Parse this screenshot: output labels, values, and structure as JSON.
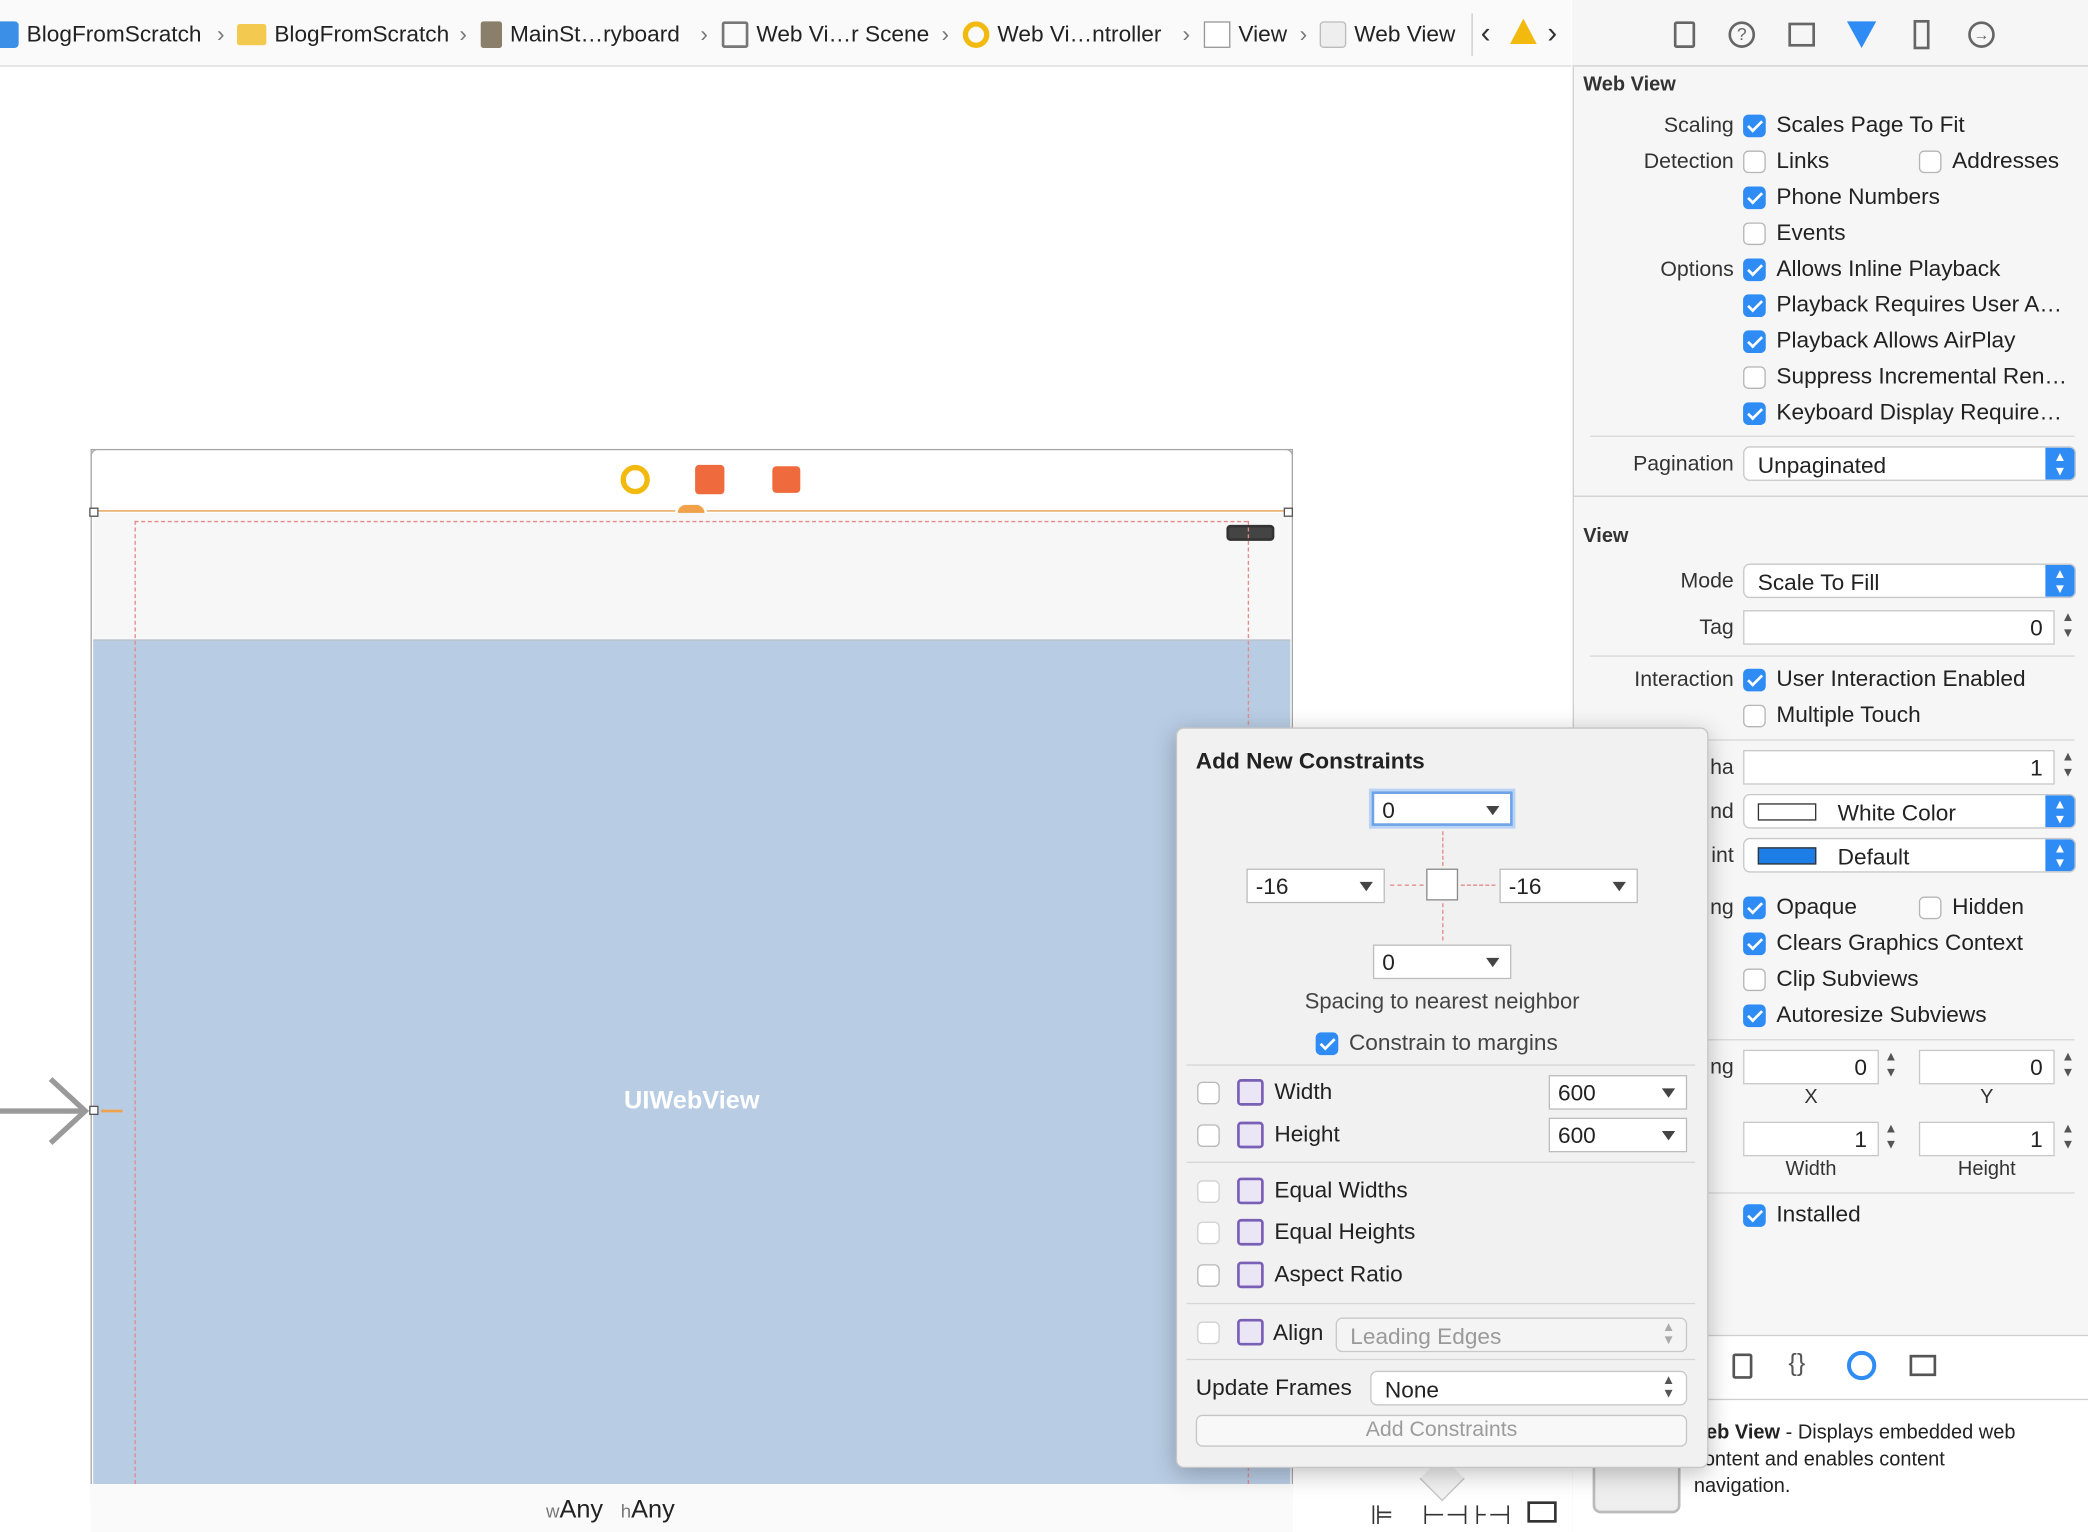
{
  "breadcrumb": [
    {
      "label": "BlogFromScratch",
      "icon": "project-icon"
    },
    {
      "label": "BlogFromScratch",
      "icon": "folder-icon"
    },
    {
      "label": "MainSt…ryboard",
      "icon": "storyboard-icon"
    },
    {
      "label": "Web Vi…r Scene",
      "icon": "scene-icon"
    },
    {
      "label": "Web Vi…ntroller",
      "icon": "view-controller-icon"
    },
    {
      "label": "View",
      "icon": "view-icon"
    },
    {
      "label": "Web View",
      "icon": "webview-icon"
    }
  ],
  "canvas": {
    "webview_label": "UIWebView",
    "size_class_w_prefix": "w",
    "size_class_w": "Any",
    "size_class_h_prefix": "h",
    "size_class_h": "Any"
  },
  "inspector": {
    "webview_section": "Web View",
    "scaling_label": "Scaling",
    "scales_page": "Scales Page To Fit",
    "detection_label": "Detection",
    "links": "Links",
    "addresses": "Addresses",
    "phone_numbers": "Phone Numbers",
    "events": "Events",
    "options_label": "Options",
    "inline_playback": "Allows Inline Playback",
    "requires_user": "Playback Requires User A…",
    "airplay": "Playback Allows AirPlay",
    "suppress": "Suppress Incremental Ren…",
    "keyboard": "Keyboard Display Require…",
    "pagination_label": "Pagination",
    "pagination_value": "Unpaginated",
    "view_section": "View",
    "mode_label": "Mode",
    "mode_value": "Scale To Fill",
    "tag_label": "Tag",
    "tag_value": "0",
    "interaction_label": "Interaction",
    "user_interaction": "User Interaction Enabled",
    "multiple_touch": "Multiple Touch",
    "alpha_label": "ha",
    "alpha_value": "1",
    "background_label": "nd",
    "background_value": "White Color",
    "tint_label": "int",
    "tint_value": "Default",
    "drawing_label": "ng",
    "opaque": "Opaque",
    "hidden": "Hidden",
    "clears": "Clears Graphics Context",
    "clip": "Clip Subviews",
    "autoresize": "Autoresize Subviews",
    "stretching_label": "ng",
    "x_value": "0",
    "y_value": "0",
    "x_label": "X",
    "y_label": "Y",
    "width_value": "1",
    "height_value": "1",
    "width_label": "Width",
    "height_label": "Height",
    "installed": "Installed",
    "library_title": "Veb View",
    "library_desc": " - Displays embedded web",
    "library_desc2": "content and enables content",
    "library_desc3": "navigation."
  },
  "popover": {
    "title": "Add New Constraints",
    "top_value": "0",
    "left_value": "-16",
    "right_value": "-16",
    "bottom_value": "0",
    "spacing_caption": "Spacing to nearest neighbor",
    "constrain_margins": "Constrain to margins",
    "width_label": "Width",
    "width_value": "600",
    "height_label": "Height",
    "height_value": "600",
    "equal_widths": "Equal Widths",
    "equal_heights": "Equal Heights",
    "aspect_ratio": "Aspect Ratio",
    "align_label": "Align",
    "align_value": "Leading Edges",
    "update_frames_label": "Update Frames",
    "update_frames_value": "None",
    "add_button": "Add Constraints"
  },
  "colors": {
    "accent": "#2f8cf5",
    "webview_bg": "#b8cce4",
    "constraint": "#e48a8a"
  }
}
